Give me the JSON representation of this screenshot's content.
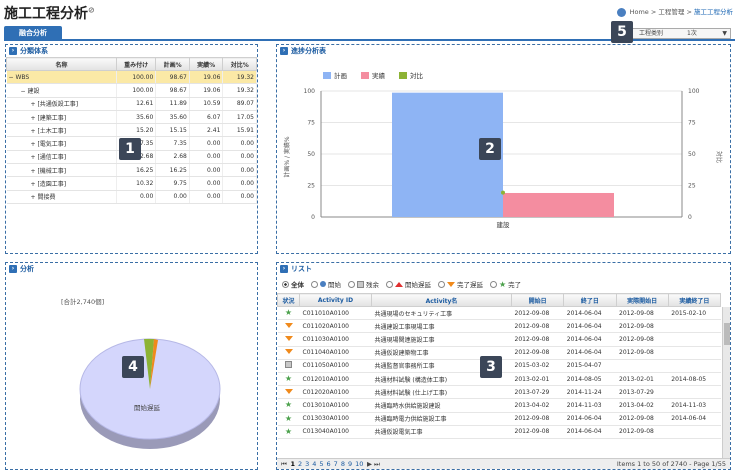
{
  "app": {
    "title": "施工工程分析",
    "breadcrumb": [
      "Home",
      "工程管理",
      "施工工程分析"
    ]
  },
  "tabs": [
    {
      "label": "融合分析"
    }
  ],
  "selector": {
    "label": "工程类别",
    "value": "1次"
  },
  "panel1": {
    "title": "分類体系",
    "columns": [
      "名称",
      "重み付け",
      "計画%",
      "実績%",
      "対比%"
    ],
    "rows": [
      {
        "name": "WBS",
        "w": "100.00",
        "p": "98.67",
        "a": "19.06",
        "c": "19.32"
      },
      {
        "name": "建設",
        "w": "100.00",
        "p": "98.67",
        "a": "19.06",
        "c": "19.32"
      },
      {
        "name": "[共通仮設工事]",
        "w": "12.61",
        "p": "11.89",
        "a": "10.59",
        "c": "89.07"
      },
      {
        "name": "[建築工事]",
        "w": "35.60",
        "p": "35.60",
        "a": "6.07",
        "c": "17.05"
      },
      {
        "name": "[土木工事]",
        "w": "15.20",
        "p": "15.15",
        "a": "2.41",
        "c": "15.91"
      },
      {
        "name": "[電気工事]",
        "w": "7.35",
        "p": "7.35",
        "a": "0.00",
        "c": "0.00"
      },
      {
        "name": "[通信工事]",
        "w": "2.68",
        "p": "2.68",
        "a": "0.00",
        "c": "0.00"
      },
      {
        "name": "[機械工事]",
        "w": "16.25",
        "p": "16.25",
        "a": "0.00",
        "c": "0.00"
      },
      {
        "name": "[造園工事]",
        "w": "10.32",
        "p": "9.75",
        "a": "0.00",
        "c": "0.00"
      },
      {
        "name": "間接費",
        "w": "0.00",
        "p": "0.00",
        "a": "0.00",
        "c": "0.00"
      }
    ]
  },
  "panel2": {
    "title": "進捗分析表"
  },
  "panel3": {
    "title": "分析",
    "total_label": "[合計2,740個]",
    "slice_label": "開始遅延"
  },
  "panel4": {
    "title": "リスト",
    "filters": [
      "全体",
      "開始",
      "残余",
      "開始遅延",
      "完了遅延",
      "完了"
    ],
    "columns": [
      "状況",
      "Activity ID",
      "Activity名",
      "開始日",
      "終了日",
      "実際開始日",
      "実績終了日"
    ],
    "rows": [
      {
        "st": "done",
        "id": "C011010A0100",
        "name": "共通現場のセキュリティ工事",
        "s": "2012-09-08",
        "e": "2014-06-04",
        "as": "2012-09-08",
        "ae": "2015-02-10"
      },
      {
        "st": "late",
        "id": "C011020A0100",
        "name": "共通建設工事現場工事",
        "s": "2012-09-08",
        "e": "2014-06-04",
        "as": "2012-09-08",
        "ae": ""
      },
      {
        "st": "late",
        "id": "C011030A0100",
        "name": "共通現場関連施設工事",
        "s": "2012-09-08",
        "e": "2014-06-04",
        "as": "2012-09-08",
        "ae": ""
      },
      {
        "st": "late",
        "id": "C011040A0100",
        "name": "共通仮設建築物工事",
        "s": "2012-09-08",
        "e": "2014-06-04",
        "as": "2012-09-08",
        "ae": ""
      },
      {
        "st": "rem",
        "id": "C011050A0100",
        "name": "共通監督官事務所工事",
        "s": "2015-03-02",
        "e": "2015-04-07",
        "as": "",
        "ae": ""
      },
      {
        "st": "done",
        "id": "C012010A0100",
        "name": "共通材料試験 (構造体工事)",
        "s": "2013-02-01",
        "e": "2014-08-05",
        "as": "2013-02-01",
        "ae": "2014-08-05"
      },
      {
        "st": "late",
        "id": "C012020A0100",
        "name": "共通材料試験 (仕上げ工事)",
        "s": "2013-07-29",
        "e": "2014-11-24",
        "as": "2013-07-29",
        "ae": ""
      },
      {
        "st": "done",
        "id": "C013010A0100",
        "name": "共通臨時水供給施設建設",
        "s": "2013-04-02",
        "e": "2014-11-03",
        "as": "2013-04-02",
        "ae": "2014-11-03"
      },
      {
        "st": "done",
        "id": "C013030A0100",
        "name": "共通臨時電力供給施設工事",
        "s": "2012-09-08",
        "e": "2014-06-04",
        "as": "2012-09-08",
        "ae": "2014-06-04"
      },
      {
        "st": "done",
        "id": "C013040A0100",
        "name": "共通仮設電気工事",
        "s": "2012-09-08",
        "e": "2014-06-04",
        "as": "2012-09-08",
        "ae": ""
      }
    ],
    "pager": {
      "pages": [
        "1",
        "2",
        "3",
        "4",
        "5",
        "6",
        "7",
        "8",
        "9",
        "10"
      ],
      "info": "Items 1 to 50 of 2740 - Page 1/55"
    }
  },
  "badges": [
    "1",
    "2",
    "3",
    "4",
    "5"
  ],
  "chart_data": {
    "type": "bar",
    "categories": [
      "建設"
    ],
    "series": [
      {
        "name": "計画",
        "values": [
          98.67
        ],
        "color": "#8eb4f4"
      },
      {
        "name": "実績",
        "values": [
          19.06
        ],
        "color": "#f48da0"
      },
      {
        "name": "対比",
        "values": [
          19.32
        ],
        "color": "#8db335"
      }
    ],
    "ylim": [
      0,
      100
    ],
    "yticks": [
      "0",
      "25",
      "50",
      "75",
      "100"
    ],
    "ylabel": "計画% / 実績%",
    "y2label": "対比",
    "legend": "top-left"
  }
}
